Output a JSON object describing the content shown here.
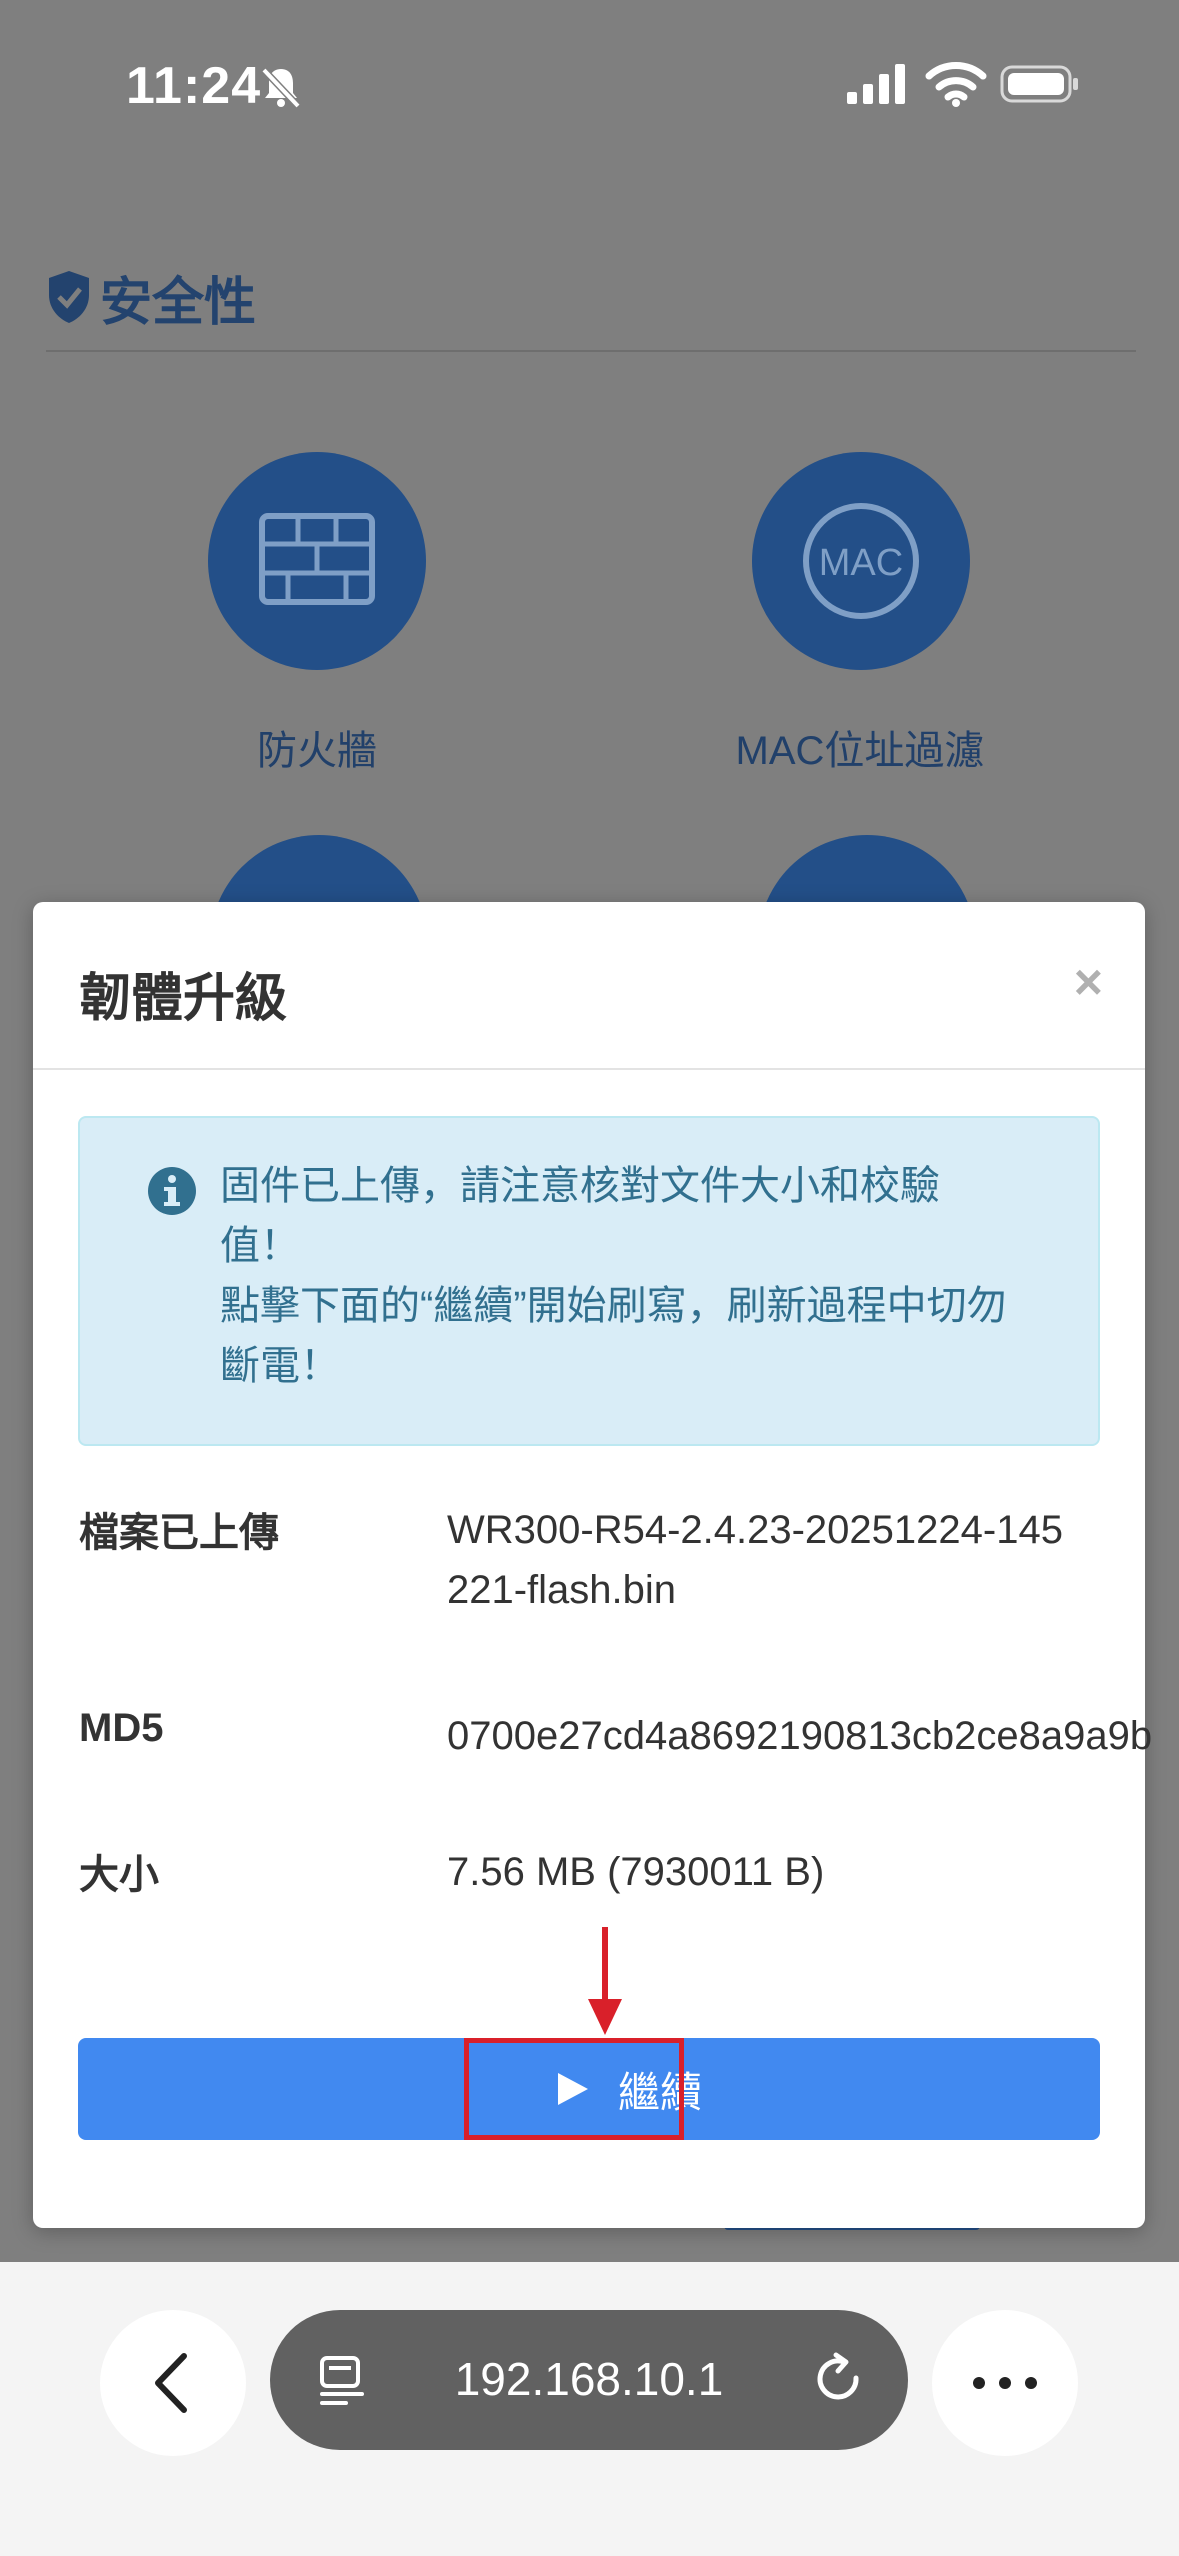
{
  "status_bar": {
    "time": "11:24"
  },
  "section": {
    "title": "安全性"
  },
  "features": [
    {
      "label": "防火牆",
      "icon": "firewall-icon"
    },
    {
      "label": "MAC位址過濾",
      "icon": "mac-icon",
      "icon_text": "MAC"
    }
  ],
  "modal": {
    "title": "韌體升級",
    "close_label": "×",
    "alert_lines": [
      "固件已上傳，請注意核對文件大小和校驗",
      "值！",
      "點擊下面的“繼續”開始刷寫，刷新過程中切勿",
      "斷電！"
    ],
    "rows": [
      {
        "label": "檔案已上傳",
        "value": "WR300-R54-2.4.23-20251224-145221-flash.bin"
      },
      {
        "label": "MD5",
        "value": "0700e27cd4a8692190813cb2ce8a9a9b"
      },
      {
        "label": "大小",
        "value": "7.56 MB (7930011 B)"
      }
    ],
    "continue_label": "繼續"
  },
  "browser": {
    "url": "192.168.10.1"
  },
  "colors": {
    "primary": "#4189f0",
    "feature_circle": "#234f88",
    "alert_bg": "#d9edf7",
    "highlight": "#d9202a"
  }
}
